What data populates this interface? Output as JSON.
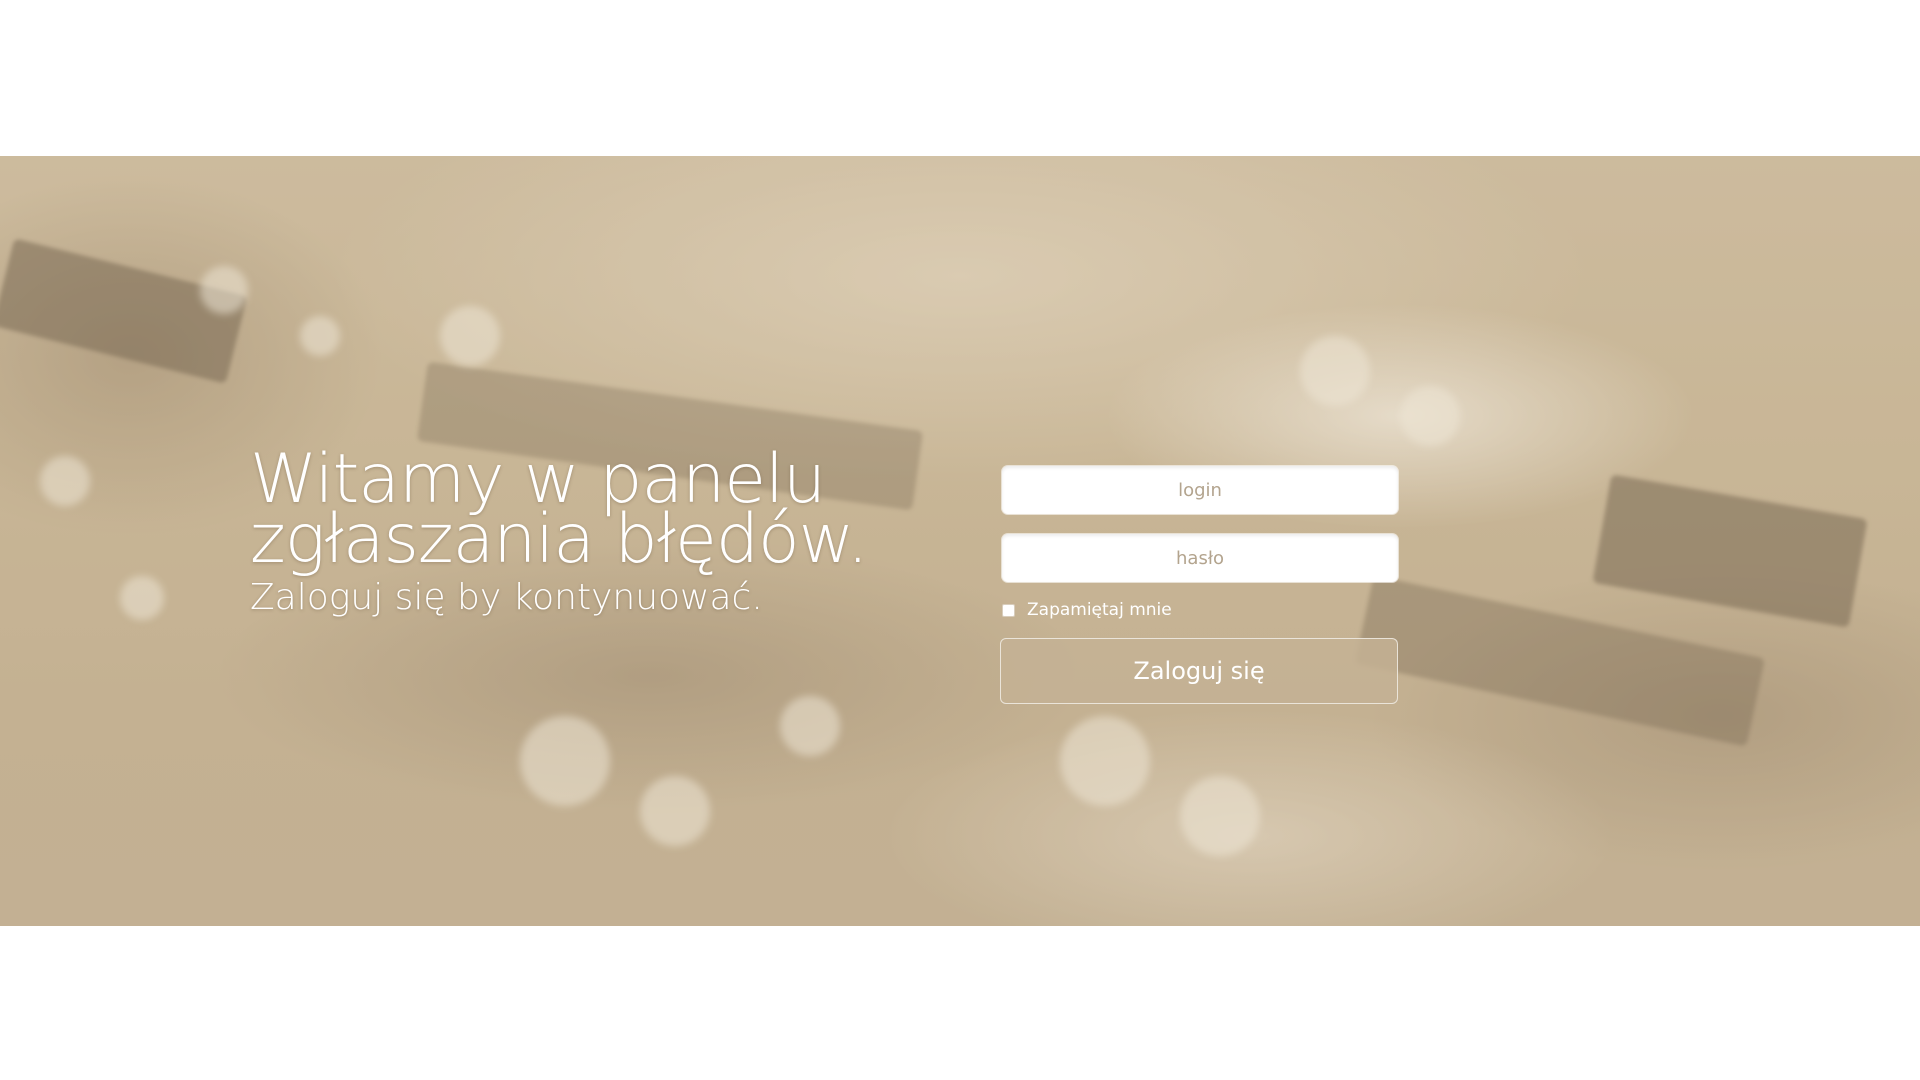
{
  "welcome": {
    "title_line1": "Witamy w panelu",
    "title_line2": "zgłaszania błędów.",
    "subtitle": "Zaloguj się by kontynuować."
  },
  "login": {
    "login_placeholder": "login",
    "password_placeholder": "hasło",
    "remember_label": "Zapamiętaj mnie",
    "remember_checked": false,
    "submit_label": "Zaloguj się"
  },
  "colors": {
    "banner_tint": "#c8b594",
    "button_fill": "#c4b294",
    "placeholder_text": "#b3a48e",
    "text_on_banner": "#ffffff"
  }
}
